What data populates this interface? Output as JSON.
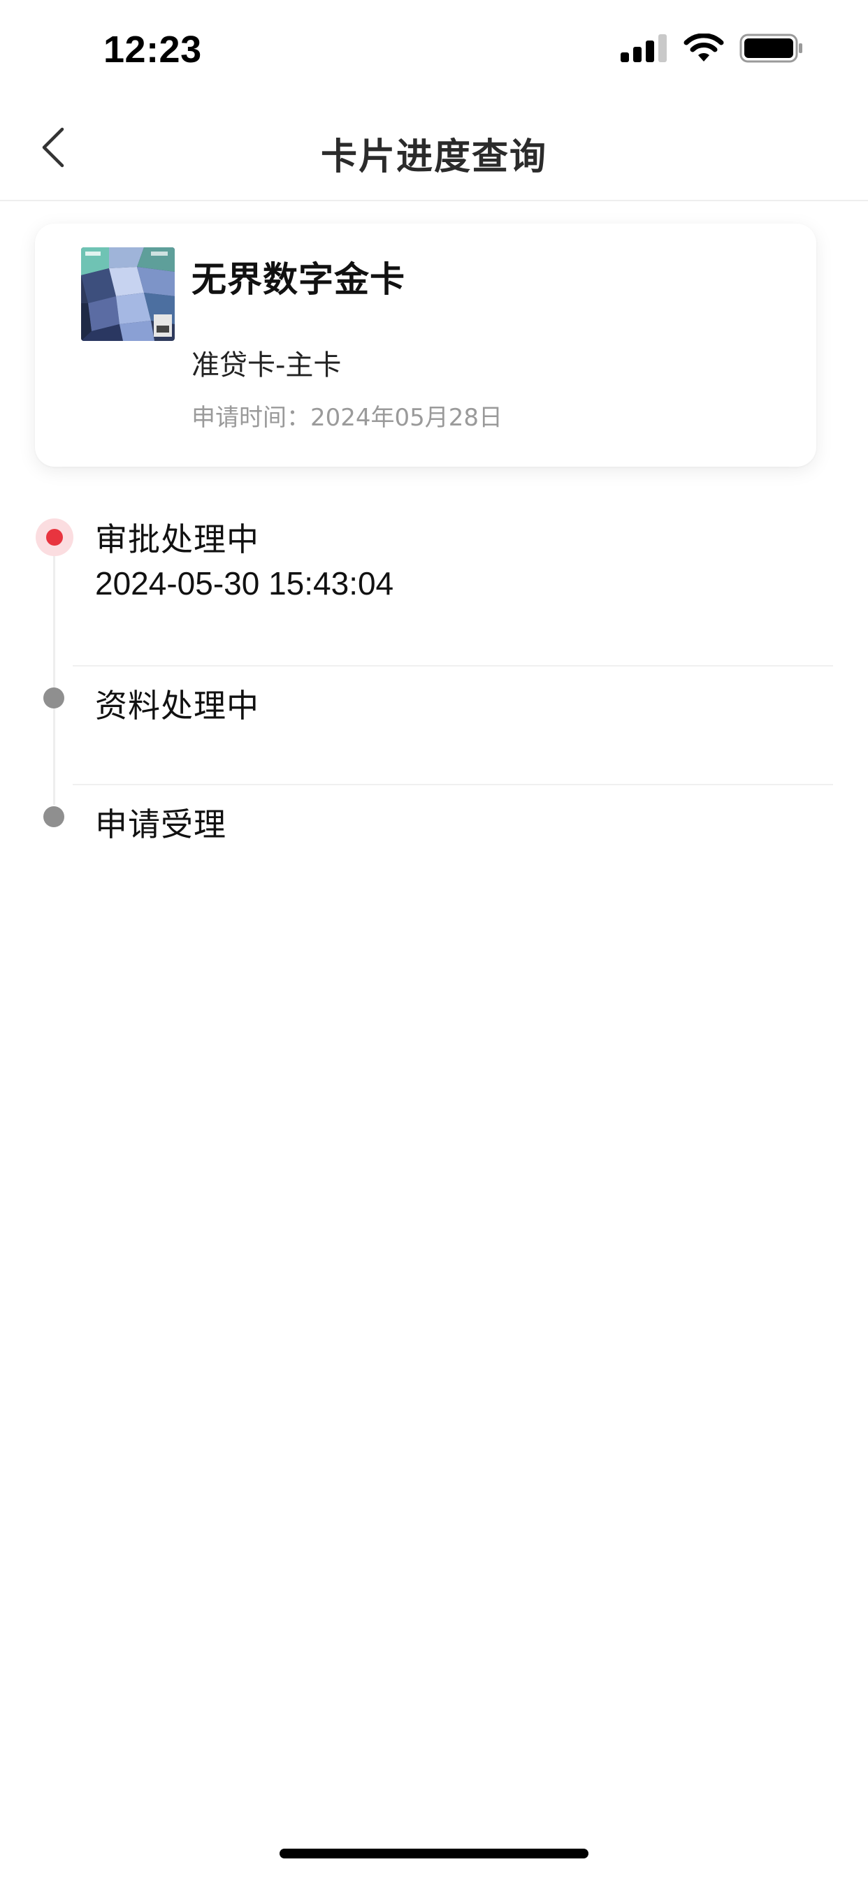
{
  "status_bar": {
    "time": "12:23",
    "icons": [
      "signal-icon",
      "wifi-icon",
      "battery-icon"
    ]
  },
  "nav": {
    "title": "卡片进度查询",
    "back_icon": "chevron-left-icon"
  },
  "card": {
    "name": "无界数字金卡",
    "type": "准贷卡-主卡",
    "apply_date": "申请时间：2024年05月28日",
    "thumbnail": "card-art-image"
  },
  "timeline": {
    "steps": [
      {
        "label": "审批处理中",
        "time": "2024-05-30 15:43:04",
        "active": true
      },
      {
        "label": "资料处理中",
        "active": false
      },
      {
        "label": "申请受理",
        "active": false
      }
    ]
  },
  "colors": {
    "active_dot": "#e8343f",
    "inactive_dot": "#8f8f8f",
    "secondary_text": "#9a9a9a"
  }
}
